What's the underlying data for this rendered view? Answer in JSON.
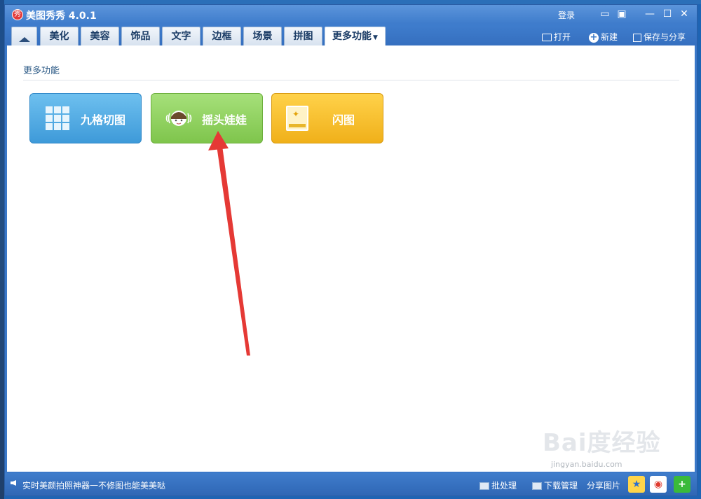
{
  "window": {
    "app_title": "美图秀秀 4.0.1",
    "logo_text": "秀",
    "login_label": "登录"
  },
  "tabs": [
    {
      "label": "",
      "icon": "home-icon"
    },
    {
      "label": "美化"
    },
    {
      "label": "美容"
    },
    {
      "label": "饰品"
    },
    {
      "label": "文字"
    },
    {
      "label": "边框"
    },
    {
      "label": "场景"
    },
    {
      "label": "拼图"
    },
    {
      "label": "更多功能",
      "active": true,
      "dropdown": true
    }
  ],
  "toolbar": {
    "open_label": "打开",
    "new_label": "新建",
    "save_label": "保存与分享"
  },
  "main": {
    "section_title": "更多功能",
    "features": [
      {
        "label": "九格切图",
        "icon": "grid-icon",
        "color": "#4aa6e0"
      },
      {
        "label": "摇头娃娃",
        "icon": "bobblehead-icon",
        "color": "#8bcf58"
      },
      {
        "label": "闪图",
        "icon": "flash-image-icon",
        "color": "#f4bd2a"
      }
    ]
  },
  "watermark": {
    "text": "Bai度经验",
    "url": "jingyan.baidu.com"
  },
  "statusbar": {
    "message": "实时美颜拍照神器一不修图也能美美哒",
    "batch_label": "批处理",
    "download_label": "下载管理",
    "share_label": "分享图片"
  },
  "colors": {
    "accent": "#3a78c8",
    "annotation_arrow": "#e53935"
  }
}
